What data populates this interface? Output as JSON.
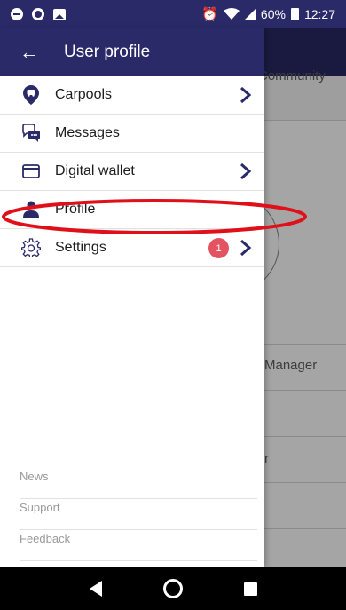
{
  "status_bar": {
    "battery": "60%",
    "time": "12:27",
    "icons": [
      "do-not-disturb-icon",
      "sync-icon",
      "image-icon",
      "alarm-icon",
      "wifi-icon",
      "signal-icon",
      "battery-icon"
    ]
  },
  "background": {
    "tab_label": "Community",
    "labels": [
      "Manager",
      "r"
    ]
  },
  "drawer": {
    "title": "User profile",
    "menu": [
      {
        "label": "Carpools",
        "icon": "carpool-pin-icon",
        "chevron": true
      },
      {
        "label": "Messages",
        "icon": "chat-icon",
        "chevron": false
      },
      {
        "label": "Digital wallet",
        "icon": "credit-card-icon",
        "chevron": true
      },
      {
        "label": "Profile",
        "icon": "person-icon",
        "chevron": false
      },
      {
        "label": "Settings",
        "icon": "gear-icon",
        "chevron": true,
        "badge": "1"
      }
    ],
    "footer": [
      "News",
      "Support",
      "Feedback"
    ]
  },
  "colors": {
    "header": "#2b2a69",
    "badge": "#e45361",
    "annotation": "#e0101a"
  }
}
